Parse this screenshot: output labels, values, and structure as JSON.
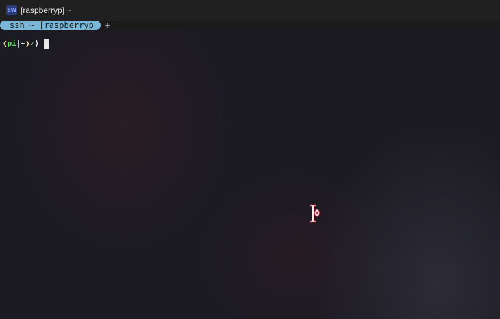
{
  "window": {
    "icon_label": "SW",
    "title": "[raspberryp] ~"
  },
  "tabs": [
    {
      "label": "ssh ~ [raspberryp"
    }
  ],
  "new_tab_label": "+",
  "terminal": {
    "prompt": {
      "open": "❮",
      "host": "pi",
      "sep": "|",
      "path": "~",
      "close": "❯",
      "check": "✓",
      "arrow": "⟩"
    },
    "input_text": ""
  },
  "colors": {
    "tab_bg": "#7ab6d8",
    "prompt_host": "#5fd75f",
    "prompt_bracket": "#f2e6a0"
  }
}
